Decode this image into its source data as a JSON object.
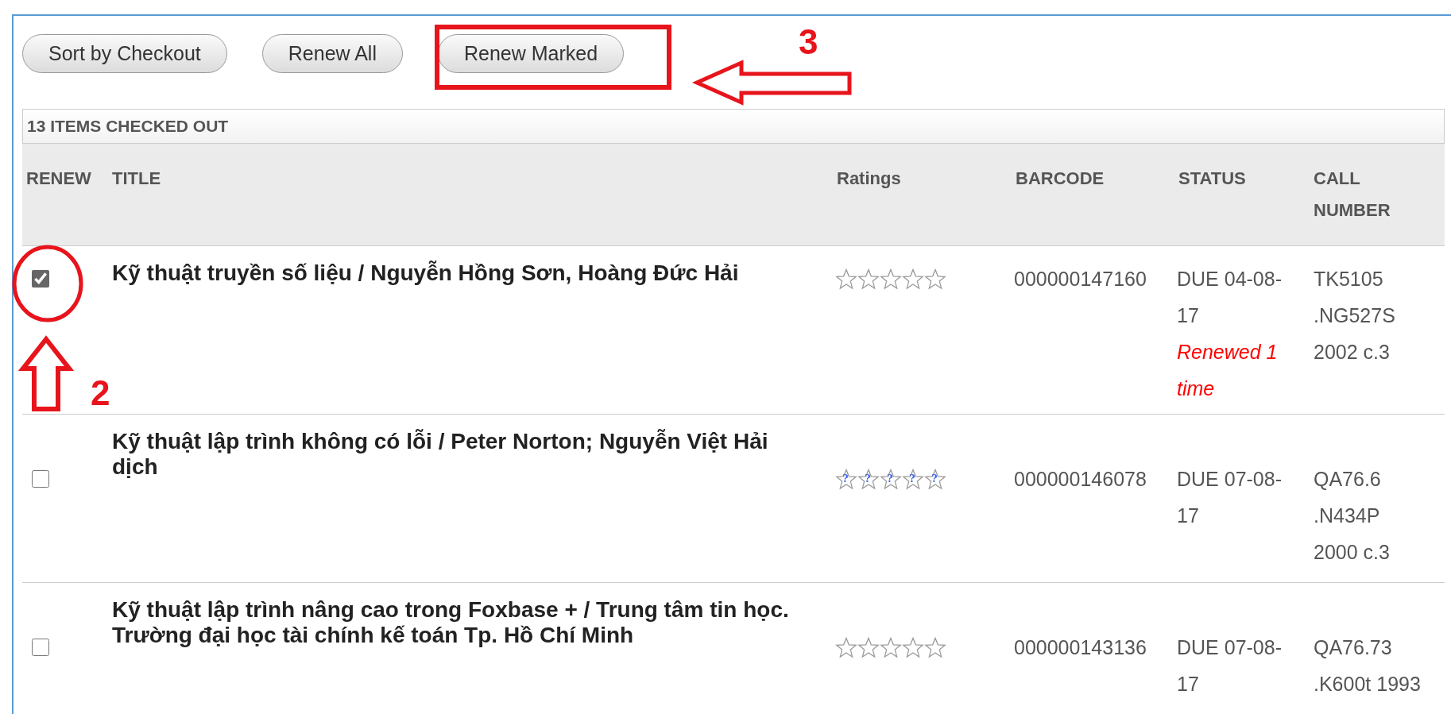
{
  "toolbar": {
    "buttons": [
      {
        "label": "Sort by Checkout"
      },
      {
        "label": "Renew All"
      },
      {
        "label": "Renew Marked"
      }
    ]
  },
  "table": {
    "caption": "13 ITEMS CHECKED OUT",
    "columns": [
      "RENEW",
      "TITLE",
      "Ratings",
      "BARCODE",
      "STATUS",
      "CALL NUMBER"
    ],
    "rows": [
      {
        "checked": true,
        "title": "Kỹ thuật truyền số liệu / Nguyễn Hồng Sơn, Hoàng Đức Hải",
        "rating": {
          "stars": 0
        },
        "barcode": "000000147160",
        "due": "DUE 04-08-17",
        "renewed": "Renewed 1 time",
        "call_number": "TK5105 .NG527S 2002 c.3"
      },
      {
        "checked": false,
        "title": "Kỹ thuật lập trình không có lỗi / Peter Norton; Nguyễn Việt Hải dịch",
        "rating": {
          "stars": 0,
          "star_marks": [
            "?",
            "?",
            "?",
            "?",
            "?"
          ]
        },
        "barcode": "000000146078",
        "due": "DUE 07-08-17",
        "call_number": "QA76.6 .N434P 2000 c.3"
      },
      {
        "checked": false,
        "title": "Kỹ thuật lập trình nâng cao trong Foxbase + / Trung tâm tin học. Trường đại học tài chính kế toán Tp. Hồ Chí Minh",
        "rating": {
          "stars": 0
        },
        "barcode": "000000143136",
        "due": "DUE 07-08-17",
        "call_number": "QA76.73 .K600t 1993"
      }
    ]
  },
  "annotations": [
    {
      "kind": "box"
    },
    {
      "kind": "arrow-left",
      "label": "3"
    },
    {
      "kind": "ellipse"
    },
    {
      "kind": "arrow-up",
      "label": "2"
    }
  ]
}
